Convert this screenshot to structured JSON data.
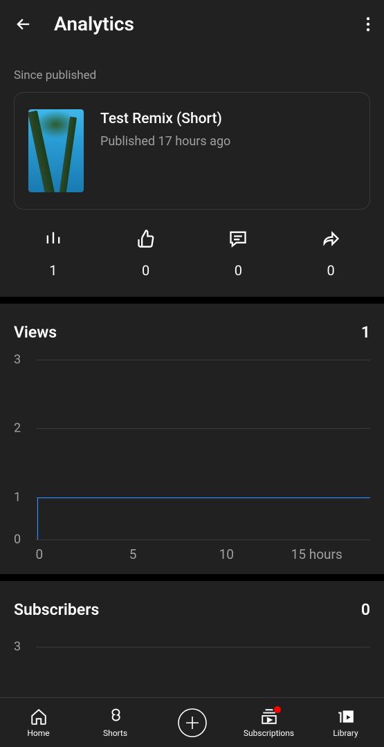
{
  "header": {
    "title": "Analytics"
  },
  "since_label": "Since published",
  "video": {
    "title": "Test Remix (Short)",
    "published": "Published 17 hours ago"
  },
  "stats": {
    "views": "1",
    "likes": "0",
    "comments": "0",
    "shares": "0"
  },
  "views_section": {
    "title": "Views",
    "value": "1"
  },
  "subscribers_section": {
    "title": "Subscribers",
    "value": "0"
  },
  "chart_data": {
    "type": "line",
    "x": [
      0,
      1,
      5,
      10,
      15,
      17
    ],
    "values": [
      0,
      1,
      1,
      1,
      1,
      1
    ],
    "xlabel": "hours",
    "ylabel": "",
    "ylim": [
      0,
      3
    ],
    "y_ticks": [
      0,
      1,
      2,
      3
    ],
    "x_ticks": [
      "0",
      "5",
      "10",
      "15 hours"
    ]
  },
  "subs_chart": {
    "y_ticks": [
      3
    ]
  },
  "nav": {
    "home": "Home",
    "shorts": "Shorts",
    "subscriptions": "Subscriptions",
    "library": "Library"
  }
}
